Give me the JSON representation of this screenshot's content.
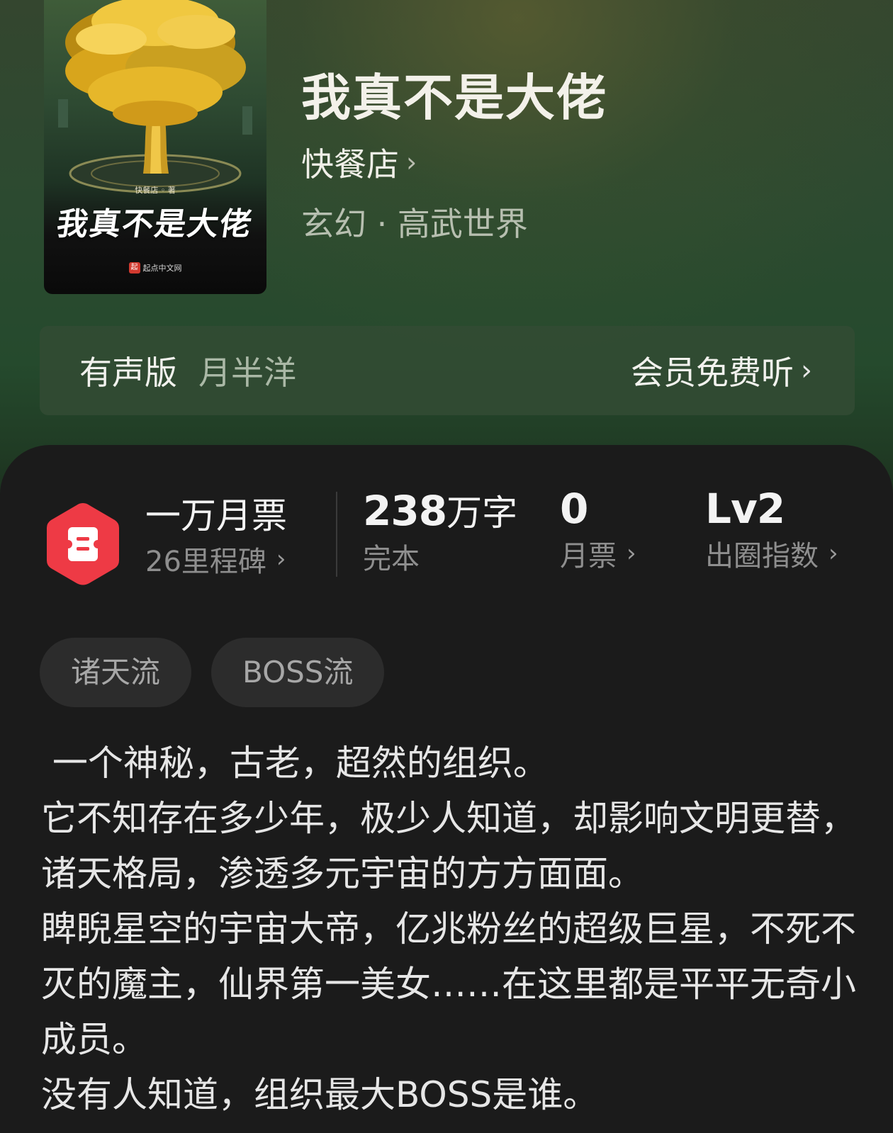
{
  "book": {
    "title": "我真不是大佬",
    "author": "快餐店",
    "category": "玄幻 · 高武世界",
    "cover": {
      "title": "我真不是大佬",
      "author_line": "快餐店 ◦ 著",
      "publisher": "起点中文网",
      "publisher_mark": "起"
    }
  },
  "audio": {
    "label": "有声版",
    "narrator": "月半洋",
    "action": "会员免费听"
  },
  "stats": {
    "ticket_title": "一万月票",
    "ticket_sub": "26里程碑",
    "words_value": "238",
    "words_unit": "万字",
    "words_sub": "完本",
    "votes_value": "0",
    "votes_sub": "月票",
    "level_value": "Lv2",
    "level_sub": "出圈指数"
  },
  "tags": [
    "诸天流",
    "BOSS流"
  ],
  "description": [
    " 一个神秘，古老，超然的组织。",
    "它不知存在多少年，极少人知道，却影响文明更替，诸天格局，渗透多元宇宙的方方面面。",
    "睥睨星空的宇宙大帝，亿兆粉丝的超级巨星，不死不灭的魔主，仙界第一美女……在这里都是平平无奇小成员。",
    "没有人知道，组织最大BOSS是谁。"
  ],
  "icons": {
    "chevron": "chevron-right-icon",
    "ticket": "monthly-ticket-icon"
  },
  "colors": {
    "ticket_red": "#ee3a45",
    "card_bg": "#1b1b1b",
    "header_green": "#254a2d"
  }
}
